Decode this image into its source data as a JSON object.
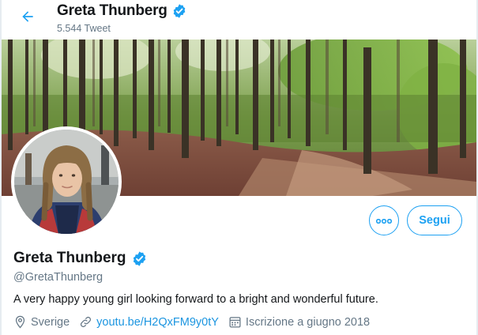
{
  "header": {
    "name": "Greta Thunberg",
    "tweet_count": "5.544 Tweet"
  },
  "profile": {
    "name": "Greta Thunberg",
    "handle": "@GretaThunberg",
    "bio": "A very happy young girl looking forward to a bright and wonderful future.",
    "location": "Sverige",
    "website": "youtu.be/H2QxFM9y0tY",
    "joined": "Iscrizione a giugno 2018"
  },
  "actions": {
    "follow_label": "Segui",
    "more_icon": "more-dots-icon"
  },
  "icons": {
    "back": "back-arrow-icon",
    "verified": "verified-badge-icon",
    "location": "location-pin-icon",
    "link": "link-icon",
    "calendar": "calendar-icon"
  },
  "colors": {
    "accent": "#1da1f2",
    "link": "#1b95e0",
    "secondary_text": "#657786",
    "primary_text": "#14171a"
  }
}
